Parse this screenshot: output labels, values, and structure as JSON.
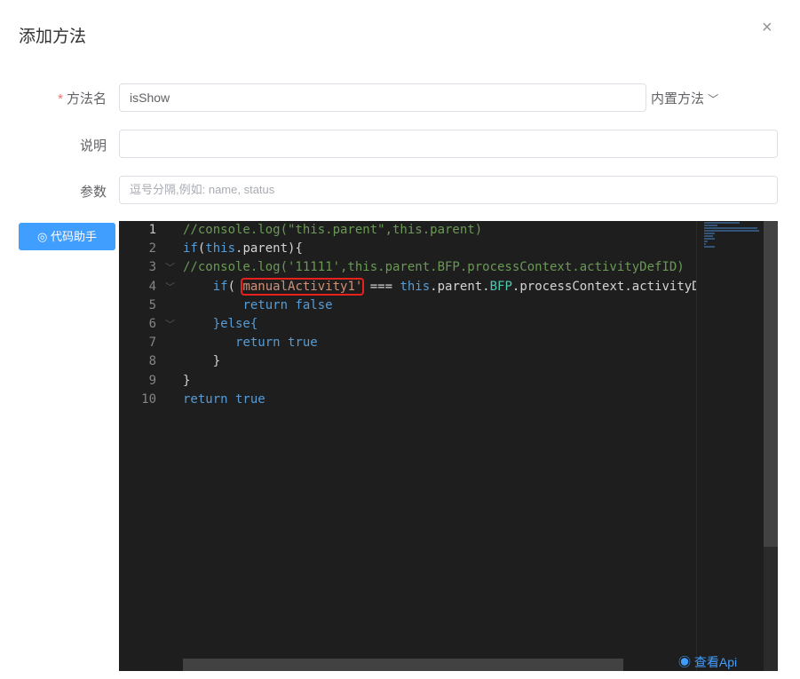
{
  "dialog": {
    "title": "添加方法",
    "close_icon": "×"
  },
  "form": {
    "name_label": "方法名",
    "name_value": "isShow",
    "builtin_label": "内置方法",
    "builtin_chevron": "﹀",
    "desc_label": "说明",
    "desc_value": "",
    "params_label": "参数",
    "params_placeholder": "逗号分隔,例如: name, status"
  },
  "helper_button": {
    "icon": "◎",
    "label": "代码助手"
  },
  "editor": {
    "line_numbers": [
      "1",
      "2",
      "3",
      "4",
      "5",
      "6",
      "7",
      "8",
      "9",
      "10"
    ],
    "view_api": "查看Api",
    "eye_icon": "◉"
  }
}
